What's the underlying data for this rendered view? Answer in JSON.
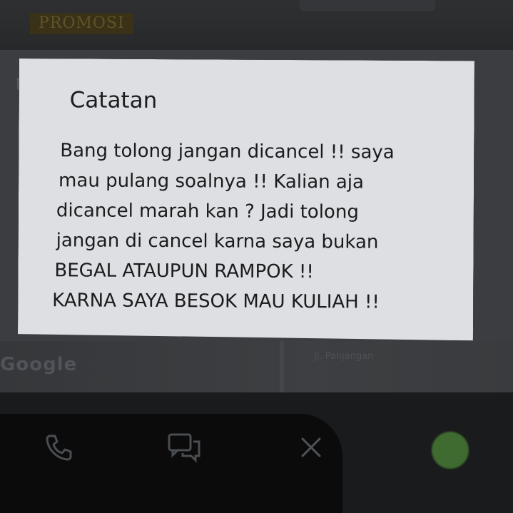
{
  "app": {
    "promo_badge": "PROMOSI",
    "background_hint": "p",
    "map_logo": "Google",
    "map_label": "Jl. Panjangan"
  },
  "dialog": {
    "title": "Catatan",
    "lines": [
      "Bang tolong jangan dicancel !! saya",
      "mau pulang soalnya !! Kalian aja",
      "dicancel marah kan ? Jadi tolong",
      "jangan di cancel karna saya bukan",
      "BEGAL ATAUPUN RAMPOK !!",
      "KARNA SAYA BESOK MAU KULIAH !!"
    ]
  },
  "actions": {
    "icons": [
      "phone-icon",
      "chat-icon",
      "close-icon"
    ]
  },
  "colors": {
    "dialog_background": "#dedfe3",
    "text": "#1b1b1d",
    "overlay_dark": "#1e1e1f",
    "accent_green": "#3f6b30"
  }
}
